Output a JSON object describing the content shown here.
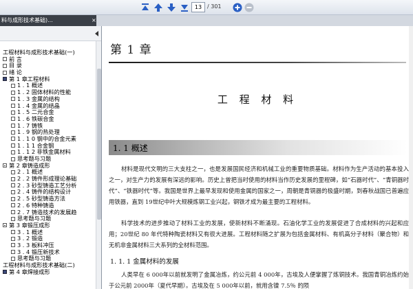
{
  "toolbar": {
    "current_page": "13",
    "total_pages": "/ 301",
    "icons": [
      "first-page-icon",
      "prev-page-icon",
      "next-page-icon",
      "last-page-icon",
      "zoom-in-icon",
      "zoom-out-icon"
    ]
  },
  "tab": {
    "title": "料与成形技术基础)...",
    "close": "×"
  },
  "tree": [
    {
      "text": "工程材料与成形技术基础(一)",
      "indent": 0,
      "box": "none"
    },
    {
      "text": "前    言",
      "indent": 1,
      "box": "plain"
    },
    {
      "text": "目    录",
      "indent": 1,
      "box": "plain"
    },
    {
      "text": "绪    论",
      "indent": 1,
      "box": "plain"
    },
    {
      "text": "第 1 章工程材料",
      "indent": 1,
      "box": "root"
    },
    {
      "text": "1 . 1   概述",
      "indent": 2,
      "box": "plain"
    },
    {
      "text": "1 . 2   固体材料的性能",
      "indent": 2,
      "box": "plain"
    },
    {
      "text": "1 . 3   金属的结构",
      "indent": 2,
      "box": "plain"
    },
    {
      "text": "1 . 4   金属的结晶",
      "indent": 2,
      "box": "plain"
    },
    {
      "text": "1 . 5   二元合金",
      "indent": 2,
      "box": "plain"
    },
    {
      "text": "1 . 6   铁碳合金",
      "indent": 2,
      "box": "plain"
    },
    {
      "text": "1 . 7   铸铁",
      "indent": 2,
      "box": "plain"
    },
    {
      "text": "1 . 9   钢的热处理",
      "indent": 2,
      "box": "plain"
    },
    {
      "text": "1 . 1 0   钢中的合金元素",
      "indent": 2,
      "box": "plain"
    },
    {
      "text": "1 . 1 1   合金钢",
      "indent": 2,
      "box": "plain"
    },
    {
      "text": "1 . 1 2   非铁金属材料",
      "indent": 2,
      "box": "plain"
    },
    {
      "text": "思考题与习题",
      "indent": 2,
      "box": "plain"
    },
    {
      "text": "第 2 章铸造成形",
      "indent": 1,
      "box": "minus"
    },
    {
      "text": "2 . 1   概述",
      "indent": 2,
      "box": "plain"
    },
    {
      "text": "2 . 2   铸件形成理论基础",
      "indent": 2,
      "box": "plain"
    },
    {
      "text": "2 . 3   砂型铸造工艺分析",
      "indent": 2,
      "box": "plain"
    },
    {
      "text": "2 . 4   铸件的结构设计",
      "indent": 2,
      "box": "plain"
    },
    {
      "text": "2 . 5   砂型铸造方法",
      "indent": 2,
      "box": "plain"
    },
    {
      "text": "2 . 6   特种铸造",
      "indent": 2,
      "box": "plain"
    },
    {
      "text": "2 . 7   铸造技术的发展趋",
      "indent": 2,
      "box": "plain"
    },
    {
      "text": "思考题与习题",
      "indent": 2,
      "box": "plain"
    },
    {
      "text": "第 3 章锻压成形",
      "indent": 1,
      "box": "minus"
    },
    {
      "text": "3 . 1   概述",
      "indent": 2,
      "box": "plain"
    },
    {
      "text": "3 . 2   锻造",
      "indent": 2,
      "box": "plain"
    },
    {
      "text": "3 . 3   板料冲压",
      "indent": 2,
      "box": "plain"
    },
    {
      "text": "3 . 4   锻压新技术",
      "indent": 2,
      "box": "plain"
    },
    {
      "text": "思考题与习题",
      "indent": 2,
      "box": "plain"
    },
    {
      "text": "工程材料与成形技术基础(二)",
      "indent": 0,
      "box": "none"
    },
    {
      "text": "第 4 章焊接成形",
      "indent": 1,
      "box": "root"
    }
  ],
  "document": {
    "chapter_label": "第  1 章",
    "chapter_title": "工 程 材 料",
    "section_title": "1. 1   概述",
    "para1": "材料是现代文明的三大支柱之一，也是发展国民经济和机械工业的重要物质基础。材料作为生产活动的基本投入之一，对生产力的发展有深远的影响。历史上曾把当时使用的材料当作历史发展的里程碑，如“石器时代”、“青铜器时代”、“铁器时代”等。我国是世界上最早发现和使用金属的国家之一，周朝是青铜器的极盛时期，到春秋战国已普遍应用铁器，直到 19世纪中叶大规模炼钢工业兴起，钢铁才成为最主要的工程材料。",
    "para2": "科学技术的进步推动了材料工业的发展，使新材料不断涌现。石油化学工业的发展促进了合成材料的兴起和应用；20世纪 80 年代特种陶瓷材料又有很大进展。工程材料随之扩展为包括金属材料、有机高分子材料（聚合物）和无机非金属材料三大系列的全材料范围。",
    "subsection_title": "1. 1. 1   金属材料的发展",
    "para3": "人类早在 6 000年以前就发明了金属冶炼，约公元前 4 000年，古埃及人便掌握了炼铜技术。我国青铜冶炼约始于公元前 2000年（夏代早期）。古埃及在 5 000年以前，就用含镍 7.5％ 的陨"
  }
}
